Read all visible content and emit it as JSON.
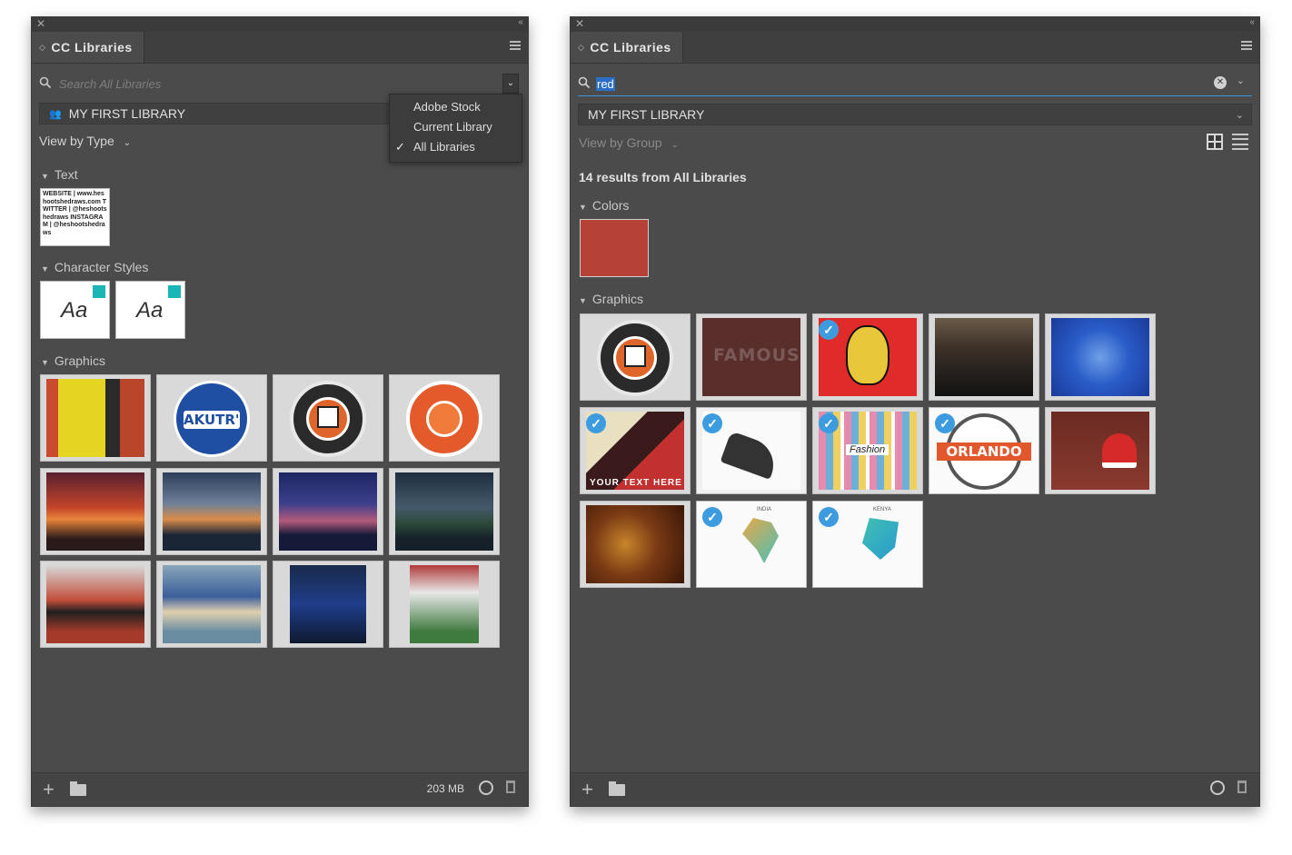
{
  "left_panel": {
    "tab_title": "CC Libraries",
    "search_placeholder": "Search All Libraries",
    "library": "MY FIRST LIBRARY",
    "view_by": "View by Type",
    "dropdown": [
      "Adobe Stock",
      "Current Library",
      "All Libraries"
    ],
    "dropdown_checked": "All Libraries",
    "sections": {
      "text": "Text",
      "char_styles": "Character Styles",
      "graphics": "Graphics"
    },
    "text_item": "WEBSITE | www.heshootshedraws.com TWITTER | @heshootshedraws INSTAGRAM | @heshootshedraws",
    "char_style_label": "Aa",
    "graphics": [
      "akutrs-sticker-icon",
      "get-inspired-badge-icon",
      "he-shoots-podcast-badge-icon"
    ],
    "storage": "203 MB"
  },
  "right_panel": {
    "tab_title": "CC Libraries",
    "search_value": "red",
    "library": "MY FIRST LIBRARY",
    "view_by": "View by Group",
    "results": "14 results from All Libraries",
    "sections": {
      "colors": "Colors",
      "graphics": "Graphics"
    },
    "swatch_color": "#b54236",
    "famous_text": "FAMOUS",
    "orlando_text": "ORLANDO",
    "your_text_here": "YOUR TEXT HERE",
    "fashion_text": "Fashion",
    "india_text": "INDIA",
    "kenya_text": "KENYA"
  }
}
